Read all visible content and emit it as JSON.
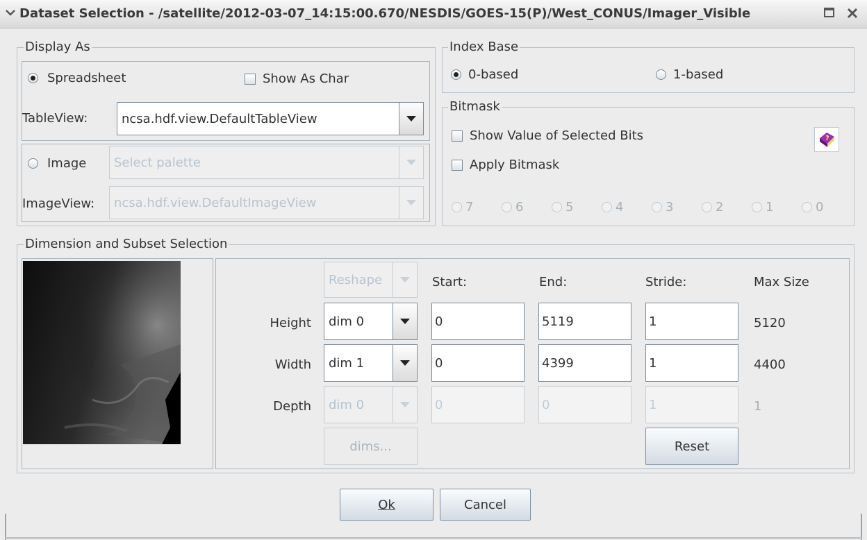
{
  "window": {
    "title": "Dataset Selection - /satellite/2012-03-07_14:15:00.670/NESDIS/GOES-15(P)/West_CONUS/Imager_Visible"
  },
  "display_as": {
    "title": "Display As",
    "spreadsheet_label": "Spreadsheet",
    "spreadsheet_selected": true,
    "show_as_char_label": "Show As Char",
    "tableview_label": "TableView:",
    "tableview_value": "ncsa.hdf.view.DefaultTableView",
    "image_label": "Image",
    "image_selected": false,
    "palette_value": "Select palette",
    "imageview_label": "ImageView:",
    "imageview_value": "ncsa.hdf.view.DefaultImageView"
  },
  "index_base": {
    "title": "Index Base",
    "zero_based_label": "0-based",
    "one_based_label": "1-based",
    "selected": "0-based"
  },
  "bitmask": {
    "title": "Bitmask",
    "show_value_label": "Show Value of Selected Bits",
    "apply_label": "Apply Bitmask",
    "bits": [
      "7",
      "6",
      "5",
      "4",
      "3",
      "2",
      "1",
      "0"
    ]
  },
  "dimension": {
    "title": "Dimension and Subset Selection",
    "reshape_value": "Reshape",
    "headers": {
      "start": "Start:",
      "end": "End:",
      "stride": "Stride:",
      "max_size": "Max Size"
    },
    "rows": [
      {
        "label": "Height",
        "dim": "dim 0",
        "start": "0",
        "end": "5119",
        "stride": "1",
        "max": "5120",
        "enabled": true
      },
      {
        "label": "Width",
        "dim": "dim 1",
        "start": "0",
        "end": "4399",
        "stride": "1",
        "max": "4400",
        "enabled": true
      },
      {
        "label": "Depth",
        "dim": "dim 0",
        "start": "0",
        "end": "0",
        "stride": "1",
        "max": "1",
        "enabled": false
      }
    ],
    "dims_button": "dims...",
    "reset_button": "Reset"
  },
  "footer": {
    "ok_label": "Ok",
    "cancel_label": "Cancel"
  },
  "icons": {
    "title_menu": "chevron-down-icon",
    "maximize": "maximize-icon",
    "close": "close-icon",
    "help": "help-book-icon"
  }
}
